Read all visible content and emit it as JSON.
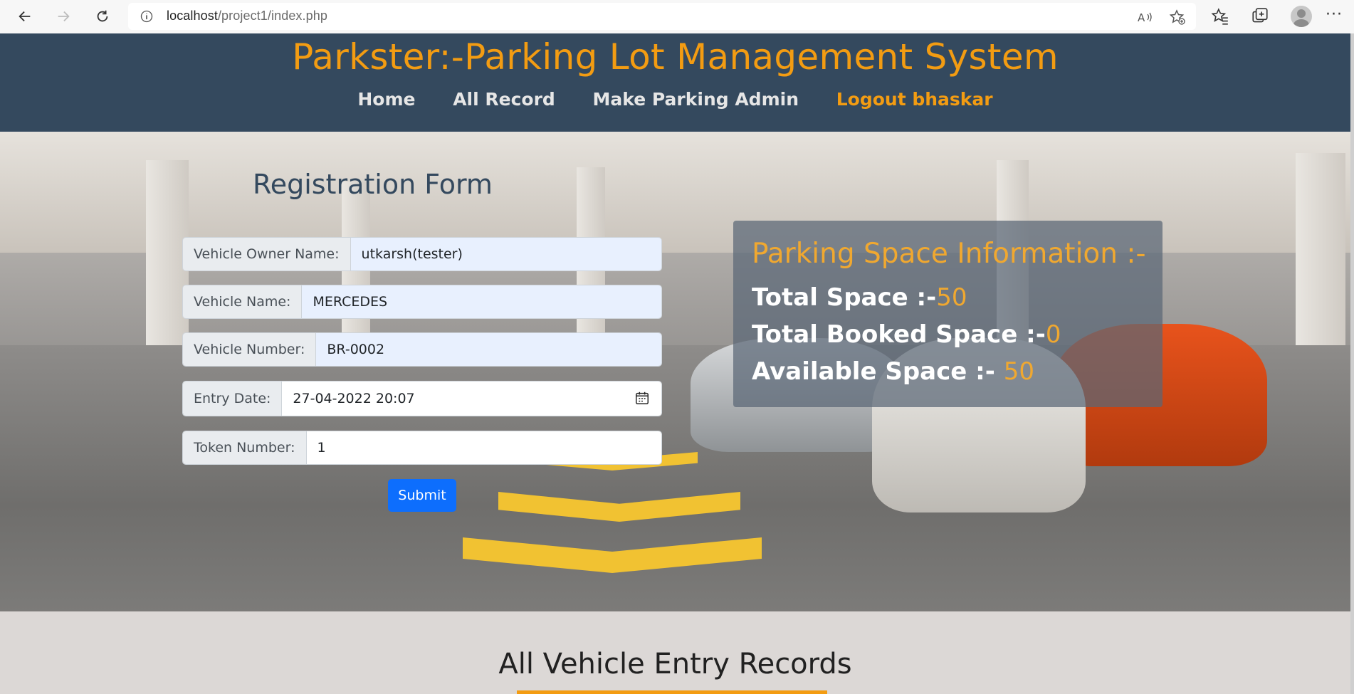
{
  "browser": {
    "url_host": "localhost",
    "url_path": "/project1/index.php"
  },
  "header": {
    "title": "Parkster:-Parking Lot Management System",
    "nav": [
      {
        "label": "Home"
      },
      {
        "label": "All Record"
      },
      {
        "label": "Make Parking Admin"
      },
      {
        "label": "Logout bhaskar"
      }
    ]
  },
  "form": {
    "title": "Registration Form",
    "fields": [
      {
        "label": "Vehicle Owner Name:",
        "value": "utkarsh(tester)"
      },
      {
        "label": "Vehicle Name:",
        "value": "MERCEDES"
      },
      {
        "label": "Vehicle Number:",
        "value": "BR-0002"
      },
      {
        "label": "Entry Date:",
        "value": "27-04-2022 20:07"
      },
      {
        "label": "Token Number:",
        "value": "1"
      }
    ],
    "submit_label": "Submit"
  },
  "info": {
    "title": "Parking Space Information :-",
    "total_label": "Total Space :-",
    "total_value": "50",
    "booked_label": "Total Booked Space :-",
    "booked_value": "0",
    "available_label": "Available Space :- ",
    "available_value": "50"
  },
  "records": {
    "title": "All Vehicle Entry Records"
  },
  "colors": {
    "header_bg": "#34495e",
    "accent": "#f39c12",
    "primary_button": "#0d6efd"
  }
}
